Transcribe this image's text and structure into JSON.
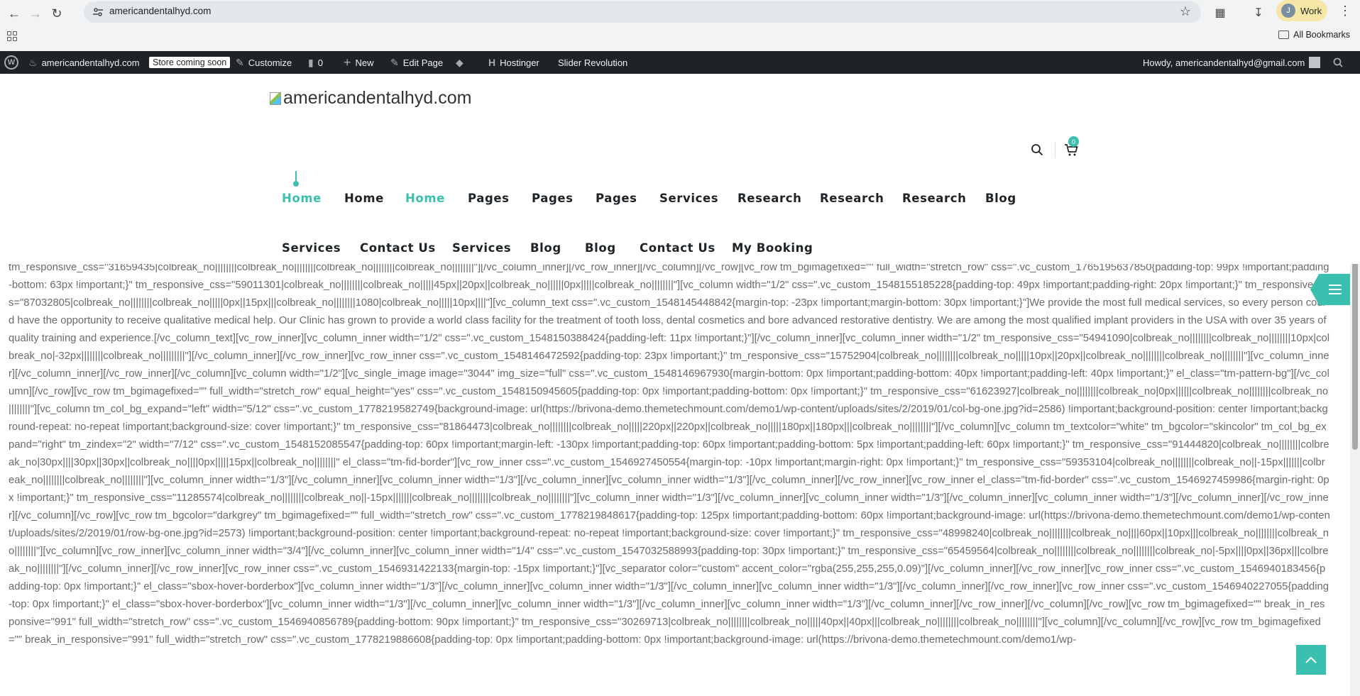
{
  "browser": {
    "url": "americandentalhyd.com",
    "profile_initial": "J",
    "profile_label": "Work",
    "bookmarks_label": "All Bookmarks",
    "icons": [
      "back-icon",
      "forward-icon",
      "reload-icon",
      "site-settings-icon",
      "star-icon",
      "extensions-icon",
      "download-icon",
      "menu-icon",
      "apps-grid-icon",
      "folder-icon"
    ]
  },
  "adminbar": {
    "site_name": "americandentalhyd.com",
    "store_badge": "Store coming soon",
    "customize": "Customize",
    "comments_count": "0",
    "new": "New",
    "edit_page": "Edit Page",
    "hostinger": "Hostinger",
    "slider_revolution": "Slider Revolution",
    "howdy": "Howdy, americandentalhyd@gmail.com"
  },
  "header": {
    "logo_alt": "americandentalhyd.com",
    "cart_count": "0",
    "accent_color": "#3bc0b0",
    "menu_row1": [
      {
        "label": "Home",
        "active": true
      },
      {
        "label": "Home",
        "active": false
      },
      {
        "label": "Home",
        "active": true
      },
      {
        "label": "Pages",
        "active": false
      },
      {
        "label": "Pages",
        "active": false
      },
      {
        "label": "Pages",
        "active": false
      },
      {
        "label": "Services",
        "active": false
      },
      {
        "label": "Research",
        "active": false
      },
      {
        "label": "Research",
        "active": false
      },
      {
        "label": "Research",
        "active": false
      },
      {
        "label": "Blog",
        "active": false
      }
    ],
    "menu_row2": [
      {
        "label": "Services"
      },
      {
        "label": "Contact Us"
      },
      {
        "label": "Services"
      },
      {
        "label": "Blog"
      },
      {
        "label": "Blog"
      },
      {
        "label": "Contact Us"
      },
      {
        "label": "My Booking"
      }
    ]
  },
  "content": {
    "text": "tm_responsive_css=\"31659435|colbreak_no||||||||colbreak_no||||||||colbreak_no||||||||colbreak_no||||||||\"][/vc_column_inner][/vc_row_inner][/vc_column][/vc_row][vc_row tm_bgimagefixed=\"\" full_width=\"stretch_row\" css=\".vc_custom_1765195637850{padding-top: 99px !important;padding-bottom: 63px !important;}\" tm_responsive_css=\"59011301|colbreak_no||||||||colbreak_no|||||45px||20px||colbreak_no||||||0px|||||colbreak_no||||||||\"][vc_column width=\"1/2\" css=\".vc_custom_1548155185228{padding-top: 49px !important;padding-right: 20px !important;}\" tm_responsive_css=\"87032805|colbreak_no||||||||colbreak_no|||||0px||15px|||colbreak_no||||||||1080|colbreak_no|||||10px||||\"][vc_column_text css=\".vc_custom_1548145448842{margin-top: -23px !important;margin-bottom: 30px !important;}\"]We provide the most full medical services, so every person could have the opportunity to receive qualitative medical help. Our Clinic has grown to provide a world class facility for the treatment of tooth loss, dental cosmetics and bore advanced restorative dentistry. We are among the most qualified implant providers in the USA with over 35 years of quality training and experience.[/vc_column_text][vc_row_inner][vc_column_inner width=\"1/2\" css=\".vc_custom_1548150388424{padding-left: 11px !important;}\"][/vc_column_inner][vc_column_inner width=\"1/2\" tm_responsive_css=\"54941090|colbreak_no||||||||colbreak_no||||||||10px|colbreak_no|-32px||||||||colbreak_no|||||||||\"][/vc_column_inner][/vc_row_inner][vc_row_inner css=\".vc_custom_1548146472592{padding-top: 23px !important;}\" tm_responsive_css=\"15752904|colbreak_no||||||||colbreak_no|||||10px||20px||colbreak_no||||||||colbreak_no||||||||\"][vc_column_inner][/vc_column_inner][/vc_row_inner][/vc_column][vc_column width=\"1/2\"][vc_single_image image=\"3044\" img_size=\"full\" css=\".vc_custom_1548146967930{margin-bottom: 0px !important;padding-bottom: 40px !important;padding-left: 40px !important;}\" el_class=\"tm-pattern-bg\"][/vc_column][/vc_row][vc_row tm_bgimagefixed=\"\" full_width=\"stretch_row\" equal_height=\"yes\" css=\".vc_custom_1548150945605{padding-top: 0px !important;padding-bottom: 0px !important;}\" tm_responsive_css=\"61623927|colbreak_no||||||||colbreak_no|0px||||||colbreak_no||||||||colbreak_no||||||||\"][vc_column tm_col_bg_expand=\"left\" width=\"5/12\" css=\".vc_custom_1778219582749{background-image: url(https://brivona-demo.themetechmount.com/demo1/wp-content/uploads/sites/2/2019/01/col-bg-one.jpg?id=2586) !important;background-position: center !important;background-repeat: no-repeat !important;background-size: cover !important;}\" tm_responsive_css=\"81864473|colbreak_no||||||||colbreak_no|||||220px||220px||colbreak_no|||||180px||180px|||colbreak_no||||||||\"][/vc_column][vc_column tm_textcolor=\"white\" tm_bgcolor=\"skincolor\" tm_col_bg_expand=\"right\" tm_zindex=\"2\" width=\"7/12\" css=\".vc_custom_1548152085547{padding-top: 60px !important;margin-left: -130px !important;padding-top: 60px !important;padding-bottom: 5px !important;padding-left: 60px !important;}\" tm_responsive_css=\"91444820|colbreak_no||||||||colbreak_no|30px||||30px||30px||colbreak_no||||0px|||||15px||colbreak_no||||||||\" el_class=\"tm-fid-border\"][vc_row_inner css=\".vc_custom_1546927450554{margin-top: -10px !important;margin-right: 0px !important;}\" tm_responsive_css=\"59353104|colbreak_no||||||||colbreak_no||-15px|||||||colbreak_no||||||||colbreak_no||||||||\"][vc_column_inner width=\"1/3\"][/vc_column_inner][vc_column_inner width=\"1/3\"][/vc_column_inner][vc_column_inner width=\"1/3\"][/vc_column_inner][/vc_row_inner][vc_row_inner el_class=\"tm-fid-border\" css=\".vc_custom_1546927459986{margin-right: 0px !important;}\" tm_responsive_css=\"11285574|colbreak_no||||||||colbreak_no||-15px|||||||colbreak_no||||||||colbreak_no||||||||\"][vc_column_inner width=\"1/3\"][/vc_column_inner][vc_column_inner width=\"1/3\"][/vc_column_inner][vc_column_inner width=\"1/3\"][/vc_column_inner][/vc_row_inner][/vc_column][/vc_row][vc_row tm_bgcolor=\"darkgrey\" tm_bgimagefixed=\"\" full_width=\"stretch_row\" css=\".vc_custom_1778219848617{padding-top: 125px !important;padding-bottom: 60px !important;background-image: url(https://brivona-demo.themetechmount.com/demo1/wp-content/uploads/sites/2/2019/01/row-bg-one.jpg?id=2573) !important;background-position: center !important;background-repeat: no-repeat !important;background-size: cover !important;}\" tm_responsive_css=\"48998240|colbreak_no||||||||colbreak_no||||60px||10px|||colbreak_no||||||||colbreak_no||||||||\"][vc_column][vc_row_inner][vc_column_inner width=\"3/4\"][/vc_column_inner][vc_column_inner width=\"1/4\" css=\".vc_custom_1547032588993{padding-top: 30px !important;}\" tm_responsive_css=\"65459564|colbreak_no||||||||colbreak_no||||||||colbreak_no|-5px||||0px||36px|||colbreak_no||||||||\"][/vc_column_inner][/vc_row_inner][vc_row_inner css=\".vc_custom_1546931422133{margin-top: -15px !important;}\"][vc_separator color=\"custom\" accent_color=\"rgba(255,255,255,0.09)\"][/vc_column_inner][/vc_row_inner][vc_row_inner css=\".vc_custom_1546940183456{padding-top: 0px !important;}\" el_class=\"sbox-hover-borderbox\"][vc_column_inner width=\"1/3\"][/vc_column_inner][vc_column_inner width=\"1/3\"][/vc_column_inner][vc_column_inner width=\"1/3\"][/vc_column_inner][/vc_row_inner][vc_row_inner css=\".vc_custom_1546940227055{padding-top: 0px !important;}\" el_class=\"sbox-hover-borderbox\"][vc_column_inner width=\"1/3\"][/vc_column_inner][vc_column_inner width=\"1/3\"][/vc_column_inner][vc_column_inner width=\"1/3\"][/vc_column_inner][/vc_row_inner][/vc_column][/vc_row][vc_row tm_bgimagefixed=\"\" break_in_responsive=\"991\" full_width=\"stretch_row\" css=\".vc_custom_1546940856789{padding-bottom: 90px !important;}\" tm_responsive_css=\"30269713|colbreak_no||||||||colbreak_no|||||40px||40px|||colbreak_no||||||||colbreak_no||||||||\"][vc_column][/vc_column][/vc_row][vc_row tm_bgimagefixed=\"\" break_in_responsive=\"991\" full_width=\"stretch_row\" css=\".vc_custom_1778219886608{padding-top: 0px !important;padding-bottom: 0px !important;background-image: url(https://brivona-demo.themetechmount.com/demo1/wp-"
  }
}
